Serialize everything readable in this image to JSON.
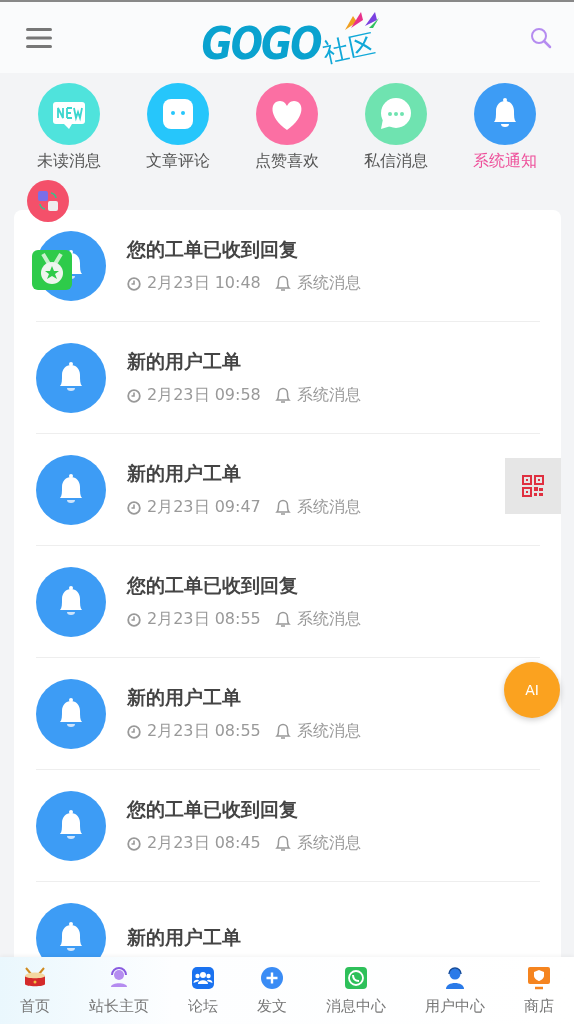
{
  "header": {
    "logo": "GOGO",
    "logo_suffix": "社区"
  },
  "categories": [
    {
      "label": "未读消息",
      "selected": false
    },
    {
      "label": "文章评论",
      "selected": false
    },
    {
      "label": "点赞喜欢",
      "selected": false
    },
    {
      "label": "私信消息",
      "selected": false
    },
    {
      "label": "系统通知",
      "selected": true
    }
  ],
  "notices": [
    {
      "title": "您的工单已收到回复",
      "time": "2月23日 10:48",
      "type": "系统消息"
    },
    {
      "title": "新的用户工单",
      "time": "2月23日 09:58",
      "type": "系统消息"
    },
    {
      "title": "新的用户工单",
      "time": "2月23日 09:47",
      "type": "系统消息"
    },
    {
      "title": "您的工单已收到回复",
      "time": "2月23日 08:55",
      "type": "系统消息"
    },
    {
      "title": "新的用户工单",
      "time": "2月23日 08:55",
      "type": "系统消息"
    },
    {
      "title": "您的工单已收到回复",
      "time": "2月23日 08:45",
      "type": "系统消息"
    },
    {
      "title": "新的用户工单"
    }
  ],
  "ai_button": "AI",
  "bottom_nav": [
    {
      "label": "首页"
    },
    {
      "label": "站长主页"
    },
    {
      "label": "论坛"
    },
    {
      "label": "发文"
    },
    {
      "label": "消息中心"
    },
    {
      "label": "用户中心"
    },
    {
      "label": "商店"
    }
  ]
}
